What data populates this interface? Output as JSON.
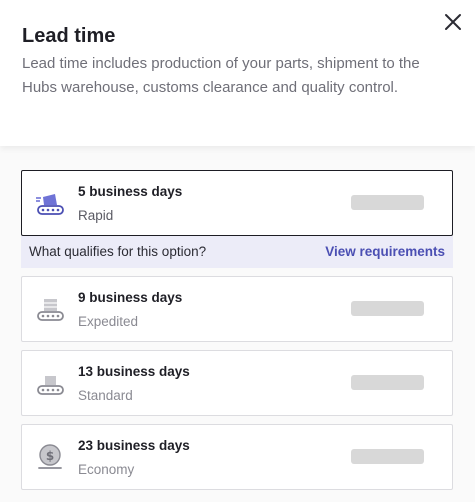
{
  "header": {
    "title": "Lead time",
    "description": "Lead time includes production of your parts, shipment to the Hubs warehouse, customs clearance and quality control."
  },
  "options": [
    {
      "days": "5 business days",
      "speed": "Rapid",
      "icon": "fast-conveyor-icon",
      "selected": true
    },
    {
      "days": "9 business days",
      "speed": "Expedited",
      "icon": "conveyor-stack-icon",
      "selected": false
    },
    {
      "days": "13 business days",
      "speed": "Standard",
      "icon": "conveyor-box-icon",
      "selected": false
    },
    {
      "days": "23 business days",
      "speed": "Economy",
      "icon": "coin-icon",
      "selected": false
    }
  ],
  "requirements": {
    "question": "What qualifies for this option?",
    "link": "View requirements"
  },
  "colors": {
    "accent": "#4b4fb3",
    "info_bar": "#ececf8",
    "placeholder": "#d8d8d8"
  }
}
